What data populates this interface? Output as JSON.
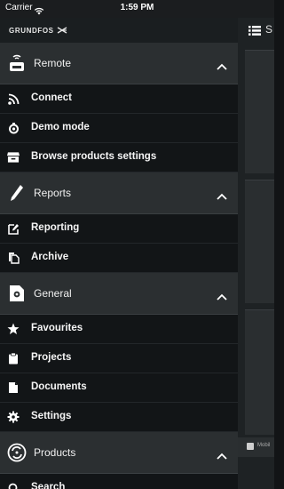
{
  "status_bar": {
    "carrier": "Carrier",
    "time": "1:59 PM"
  },
  "brand": {
    "logo_text": "GRUNDFOS"
  },
  "sections": [
    {
      "label": "Remote",
      "icon": "remote-icon",
      "items": [
        {
          "label": "Connect",
          "icon": "rss-icon"
        },
        {
          "label": "Demo mode",
          "icon": "demo-icon"
        },
        {
          "label": "Browse products settings",
          "icon": "archive-box-icon"
        }
      ]
    },
    {
      "label": "Reports",
      "icon": "pencil-icon",
      "items": [
        {
          "label": "Reporting",
          "icon": "edit-icon"
        },
        {
          "label": "Archive",
          "icon": "copy-icon"
        }
      ]
    },
    {
      "label": "General",
      "icon": "gear-document-icon",
      "items": [
        {
          "label": "Favourites",
          "icon": "star-icon"
        },
        {
          "label": "Projects",
          "icon": "clipboard-icon"
        },
        {
          "label": "Documents",
          "icon": "document-icon"
        },
        {
          "label": "Settings",
          "icon": "gear-icon"
        }
      ]
    },
    {
      "label": "Products",
      "icon": "products-icon",
      "items": [
        {
          "label": "Search",
          "icon": "search-icon"
        }
      ]
    }
  ],
  "main": {
    "title_partial": "S",
    "footer_text": "Mobil"
  },
  "colors": {
    "drawer_bg": "#15191b",
    "section_bg": "#2b2f31",
    "text": "#ffffff"
  }
}
